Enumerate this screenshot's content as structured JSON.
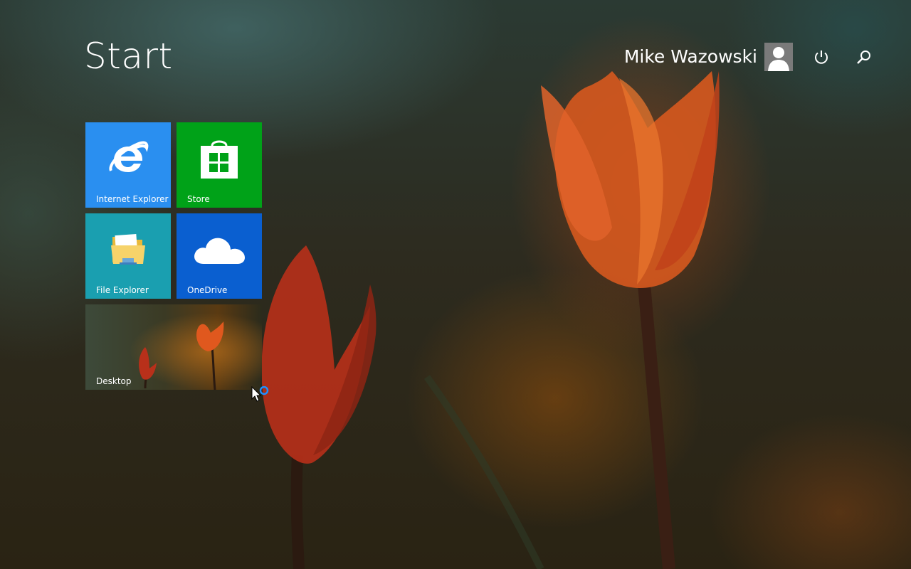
{
  "start": {
    "title": "Start"
  },
  "user": {
    "name": "Mike Wazowski",
    "avatar_icon": "user-silhouette-icon"
  },
  "top_actions": [
    {
      "name": "power",
      "icon": "power-icon"
    },
    {
      "name": "search",
      "icon": "search-icon"
    }
  ],
  "tiles": [
    {
      "label": "Internet Explorer",
      "icon": "internet-explorer-icon",
      "color": "#2a8ff0"
    },
    {
      "label": "Store",
      "icon": "store-bag-icon",
      "color": "#00a218"
    },
    {
      "label": "File Explorer",
      "icon": "folder-icon",
      "color": "#1a9fb0"
    },
    {
      "label": "OneDrive",
      "icon": "cloud-icon",
      "color": "#0a5fd0"
    },
    {
      "label": "Desktop",
      "icon": "desktop-wallpaper-thumbnail",
      "color": "#3b3a24"
    }
  ],
  "cursor": {
    "state": "busy"
  }
}
